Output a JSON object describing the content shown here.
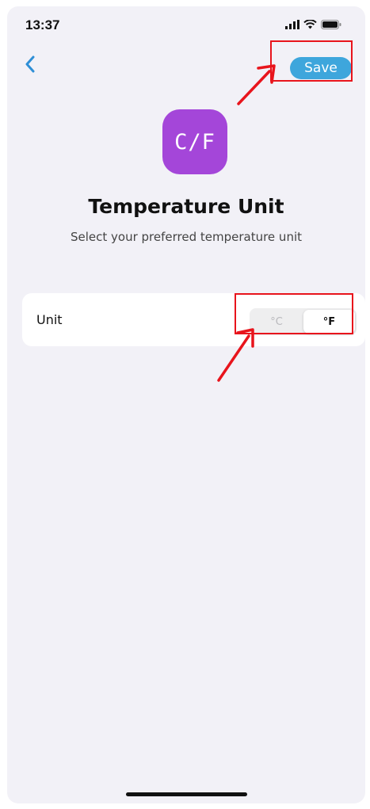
{
  "status_bar": {
    "time": "13:37",
    "icons": [
      "cellular-signal-icon",
      "wifi-icon",
      "battery-icon"
    ]
  },
  "nav": {
    "back_icon": "chevron-left-icon",
    "save_label": "Save"
  },
  "header": {
    "app_icon_text": "C/F",
    "title": "Temperature Unit",
    "subtitle": "Select your preferred temperature unit"
  },
  "settings": {
    "unit_label": "Unit",
    "options": [
      "°C",
      "°F"
    ],
    "selected": "°F"
  },
  "colors": {
    "accent": "#3ea6dc",
    "app_icon": "#a446d9",
    "annotation": "#e8141c",
    "background": "#f2f1f7"
  },
  "annotations": {
    "highlight_boxes": [
      "save-button",
      "unit-segmented-control"
    ],
    "arrows": 2
  }
}
